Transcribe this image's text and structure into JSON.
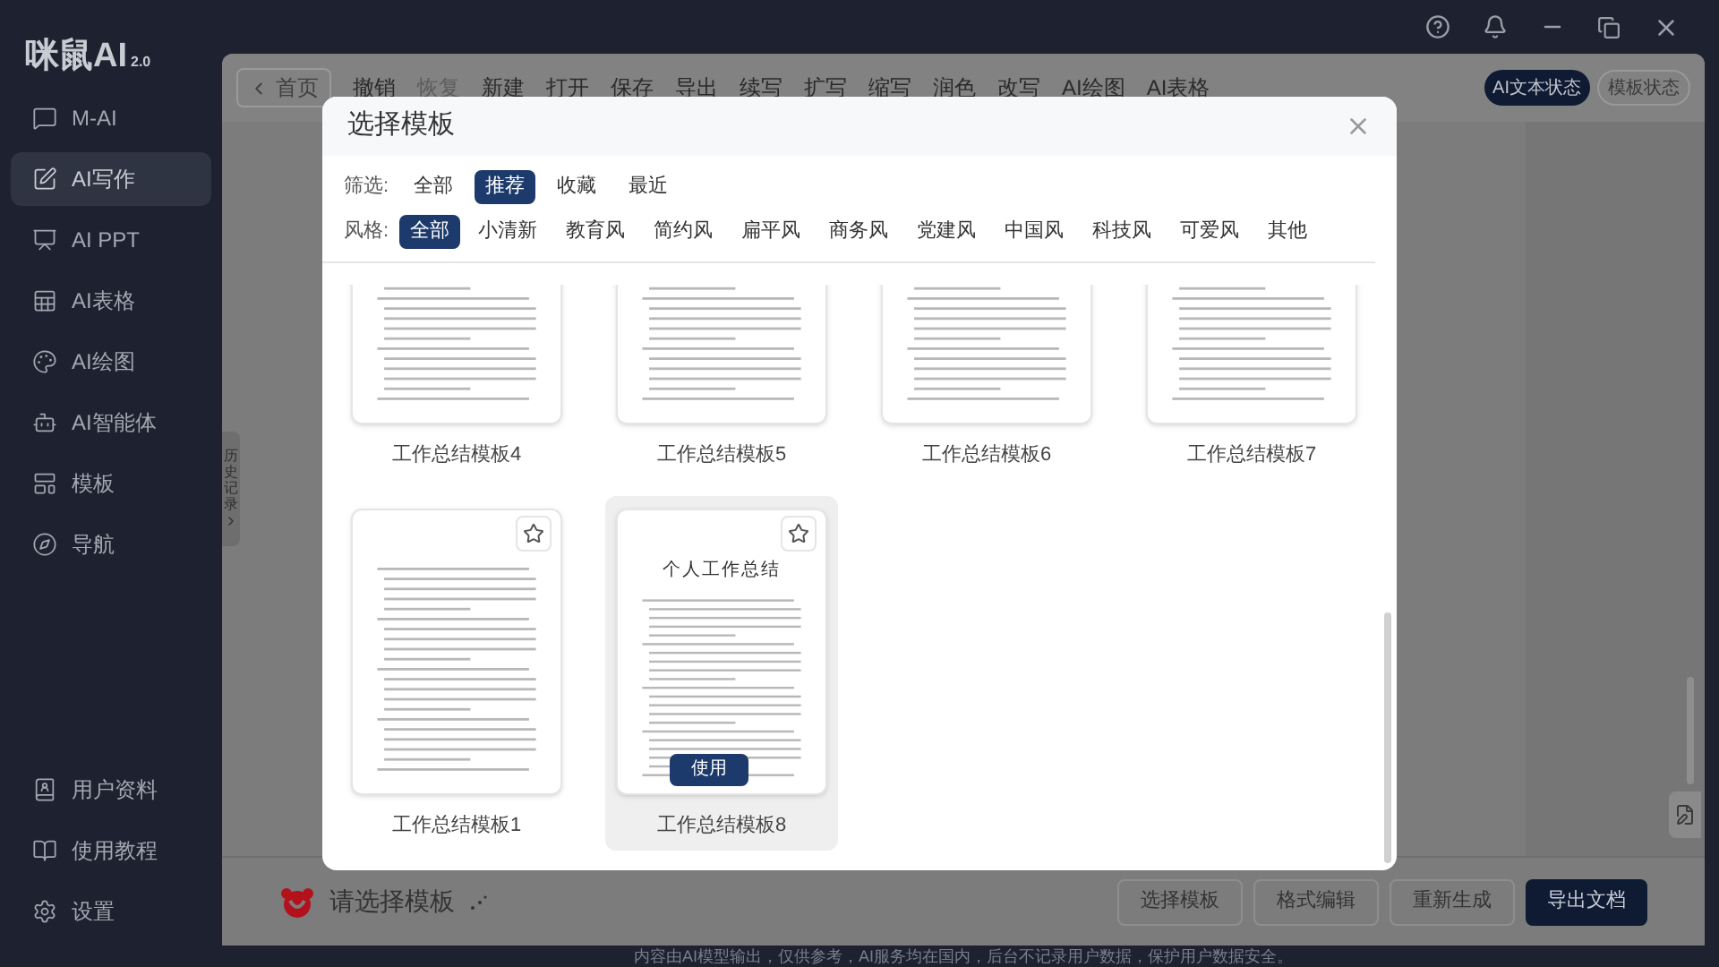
{
  "app": {
    "logo": "咪鼠AI",
    "version": "2.0"
  },
  "sidebar": {
    "items": [
      {
        "label": "M-AI",
        "selected": false
      },
      {
        "label": "AI写作",
        "selected": true
      },
      {
        "label": "AI PPT",
        "selected": false
      },
      {
        "label": "AI表格",
        "selected": false
      },
      {
        "label": "AI绘图",
        "selected": false
      },
      {
        "label": "AI智能体",
        "selected": false
      },
      {
        "label": "模板",
        "selected": false
      },
      {
        "label": "导航",
        "selected": false
      }
    ],
    "bottom_items": [
      {
        "label": "用户资料"
      },
      {
        "label": "使用教程"
      },
      {
        "label": "设置"
      }
    ]
  },
  "toolbar": {
    "home": "首页",
    "items": [
      {
        "label": "撤销",
        "disabled": false
      },
      {
        "label": "恢复",
        "disabled": true
      },
      {
        "label": "新建",
        "disabled": false
      },
      {
        "label": "打开",
        "disabled": false
      },
      {
        "label": "保存",
        "disabled": false
      },
      {
        "label": "导出",
        "disabled": false
      },
      {
        "label": "续写",
        "disabled": false
      },
      {
        "label": "扩写",
        "disabled": false
      },
      {
        "label": "缩写",
        "disabled": false
      },
      {
        "label": "润色",
        "disabled": false
      },
      {
        "label": "改写",
        "disabled": false
      },
      {
        "label": "AI绘图",
        "disabled": false
      },
      {
        "label": "AI表格",
        "disabled": false
      }
    ],
    "modes": [
      {
        "label": "AI文本状态",
        "selected": true
      },
      {
        "label": "模板状态",
        "selected": false
      }
    ]
  },
  "history_tab": "历史记录",
  "bottom_bar": {
    "prompt": "请选择模板",
    "buttons": [
      {
        "label": "选择模板",
        "primary": false
      },
      {
        "label": "格式编辑",
        "primary": false
      },
      {
        "label": "重新生成",
        "primary": false
      },
      {
        "label": "导出文档",
        "primary": true
      }
    ]
  },
  "footer": "内容由AI模型输出，仅供参考，AI服务均在国内，后台不记录用户数据，保护用户数据安全。",
  "dialog": {
    "title": "选择模板",
    "filter_label": "筛选:",
    "filters": [
      {
        "label": "全部",
        "selected": false
      },
      {
        "label": "推荐",
        "selected": true
      },
      {
        "label": "收藏",
        "selected": false
      },
      {
        "label": "最近",
        "selected": false
      }
    ],
    "style_label": "风格:",
    "styles": [
      {
        "label": "全部",
        "selected": true
      },
      {
        "label": "小清新",
        "selected": false
      },
      {
        "label": "教育风",
        "selected": false
      },
      {
        "label": "简约风",
        "selected": false
      },
      {
        "label": "扁平风",
        "selected": false
      },
      {
        "label": "商务风",
        "selected": false
      },
      {
        "label": "党建风",
        "selected": false
      },
      {
        "label": "中国风",
        "selected": false
      },
      {
        "label": "科技风",
        "selected": false
      },
      {
        "label": "可爱风",
        "selected": false
      },
      {
        "label": "其他",
        "selected": false
      }
    ],
    "use_label": "使用",
    "templates": [
      {
        "name": "工作总结模板4",
        "selected": false
      },
      {
        "name": "工作总结模板5",
        "selected": false
      },
      {
        "name": "工作总结模板6",
        "selected": false
      },
      {
        "name": "工作总结模板7",
        "selected": false
      },
      {
        "name": "工作总结模板1",
        "selected": false
      },
      {
        "name": "工作总结模板8",
        "selected": true,
        "preview_title": "个人工作总结"
      }
    ]
  }
}
